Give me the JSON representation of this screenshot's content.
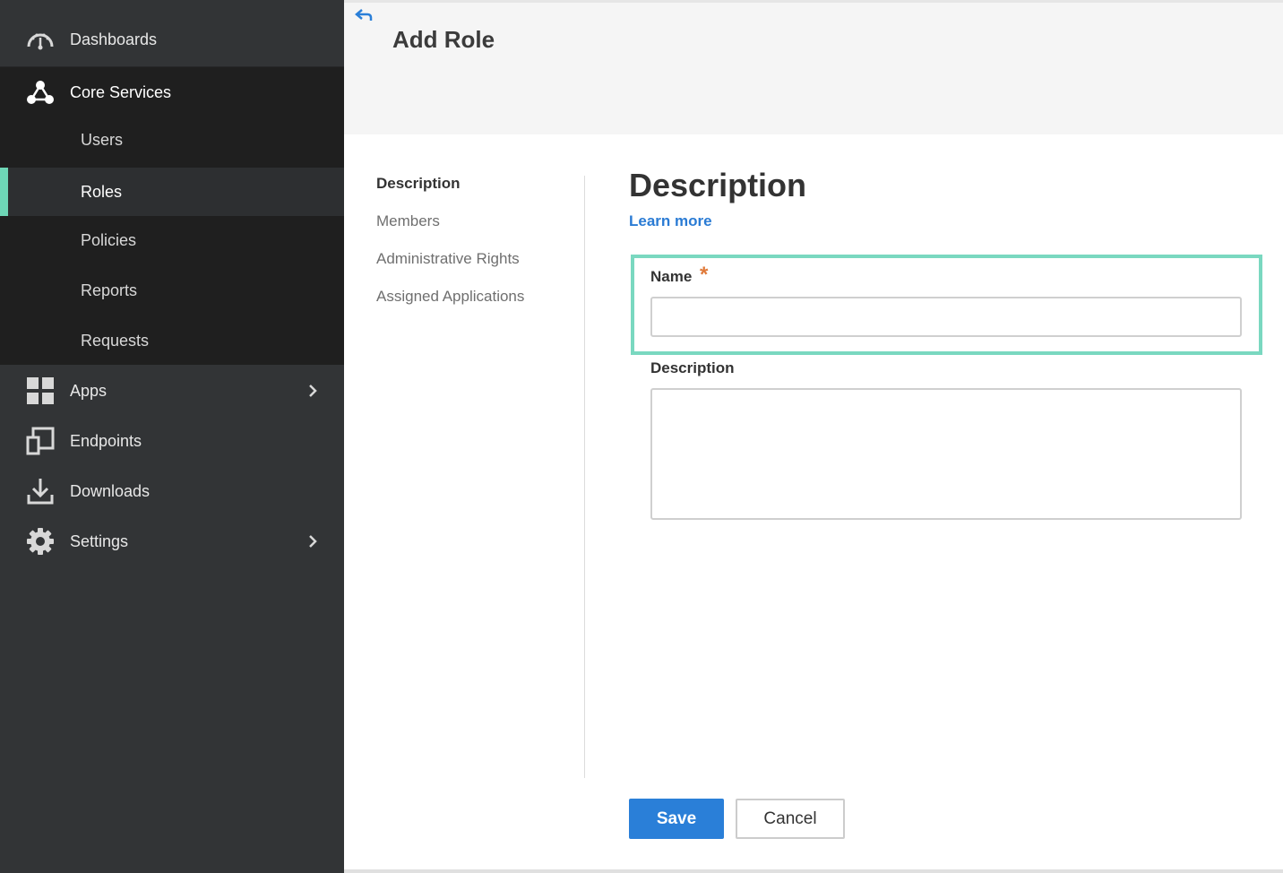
{
  "sidebar": {
    "dashboards": {
      "label": "Dashboards",
      "icon": "speedometer-icon"
    },
    "core_services": {
      "label": "Core Services",
      "icon": "network-icon",
      "items": [
        {
          "label": "Users"
        },
        {
          "label": "Roles",
          "active": true
        },
        {
          "label": "Policies"
        },
        {
          "label": "Reports"
        },
        {
          "label": "Requests"
        }
      ]
    },
    "apps": {
      "label": "Apps",
      "icon": "grid-icon"
    },
    "endpoints": {
      "label": "Endpoints",
      "icon": "devices-icon"
    },
    "downloads": {
      "label": "Downloads",
      "icon": "download-icon"
    },
    "settings": {
      "label": "Settings",
      "icon": "gear-icon"
    }
  },
  "header": {
    "title": "Add Role",
    "back_icon": "back-arrow-icon"
  },
  "section_nav": {
    "items": [
      {
        "label": "Description",
        "active": true
      },
      {
        "label": "Members"
      },
      {
        "label": "Administrative Rights"
      },
      {
        "label": "Assigned Applications"
      }
    ]
  },
  "form": {
    "title": "Description",
    "learn_more": "Learn more",
    "name_label": "Name",
    "required_marker": "*",
    "name_value": "",
    "description_label": "Description",
    "description_value": ""
  },
  "actions": {
    "save_label": "Save",
    "cancel_label": "Cancel"
  },
  "colors": {
    "accent": "#6ed6b6",
    "primary": "#2a7fd8",
    "required": "#e07a3a",
    "highlight": "#7ad8c0",
    "sidebar_bg": "#323436"
  }
}
